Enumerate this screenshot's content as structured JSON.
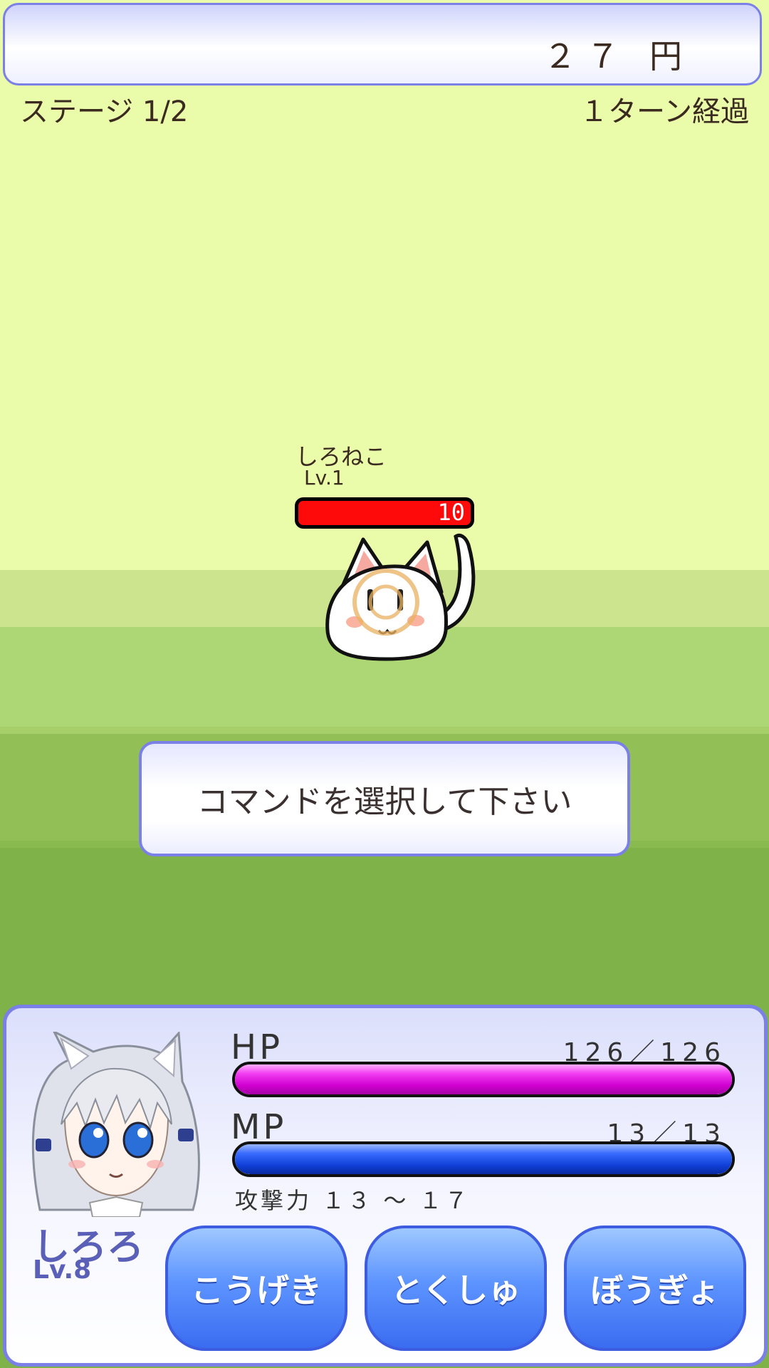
{
  "header": {
    "money": "２７ 円",
    "stage": "ステージ 1/2",
    "turn": "１ターン経過"
  },
  "enemy": {
    "name": "しろねこ",
    "level": "Lv.1",
    "hp": "10",
    "hp_fraction": 1.0
  },
  "message": "コマンドを選択して下さい",
  "player": {
    "name": "しろろ",
    "level": "Lv.8",
    "hp_label": "HP",
    "hp_value": "126／126",
    "hp_fraction": 1.0,
    "mp_label": "MP",
    "mp_value": "13／13",
    "mp_fraction": 1.0,
    "attack": "攻撃力 １３ ～ １７"
  },
  "commands": {
    "attack": "こうげき",
    "special": "とくしゅ",
    "defend": "ぼうぎょ"
  },
  "colors": {
    "sky": "#eafcaa",
    "accent_border": "#7b80e8",
    "enemy_hp": "#ff0a0a",
    "player_hp": "#d100d1",
    "player_mp": "#1040d8",
    "button": "#5d94ff"
  }
}
